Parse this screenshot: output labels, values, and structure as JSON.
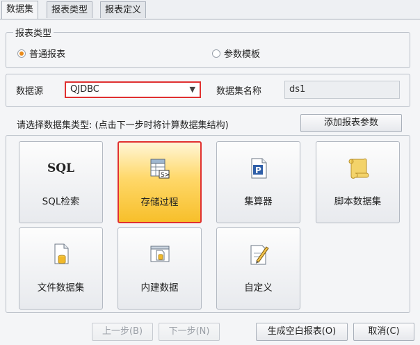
{
  "tabs": [
    {
      "label": "数据集"
    },
    {
      "label": "报表类型"
    },
    {
      "label": "报表定义"
    }
  ],
  "report_type": {
    "group_label": "报表类型",
    "options": [
      {
        "label": "普通报表",
        "selected": true
      },
      {
        "label": "参数模板",
        "selected": false
      }
    ]
  },
  "datasource": {
    "label": "数据源",
    "value": "QJDBC",
    "dataset_name_label": "数据集名称",
    "dataset_name_value": "ds1"
  },
  "instruction": "请选择数据集类型: (点击下一步时将计算数据集结构)",
  "add_param_button": "添加报表参数",
  "dataset_types": [
    {
      "label": "SQL检索",
      "icon": "sql-text-icon",
      "icon_text": "SQL",
      "selected": false
    },
    {
      "label": "存储过程",
      "icon": "stored-procedure-icon",
      "selected": true
    },
    {
      "label": "集算器",
      "icon": "esproc-icon",
      "selected": false
    },
    {
      "label": "脚本数据集",
      "icon": "script-scroll-icon",
      "selected": false
    },
    {
      "label": "文件数据集",
      "icon": "file-dataset-icon",
      "selected": false
    },
    {
      "label": "内建数据",
      "icon": "builtin-data-icon",
      "selected": false
    },
    {
      "label": "自定义",
      "icon": "custom-edit-icon",
      "selected": false
    }
  ],
  "footer": {
    "prev": "上一步(B)",
    "next": "下一步(N)",
    "generate_blank": "生成空白报表(O)",
    "cancel": "取消(C)"
  },
  "colors": {
    "selection_border": "#e03030",
    "radio_accent": "#e98a1a",
    "selected_tile": "#f7bf2a"
  }
}
